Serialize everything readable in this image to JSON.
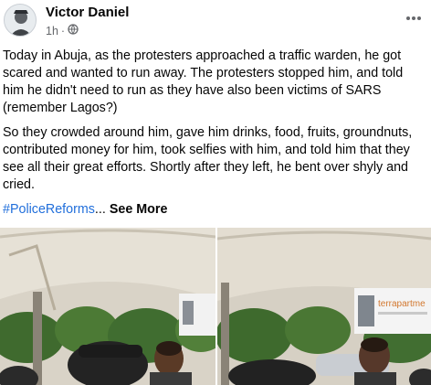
{
  "post": {
    "author": "Victor Daniel",
    "time": "1h",
    "time_separator": "·",
    "paragraph1": "Today in Abuja, as the protesters approached a traffic warden, he got scared and wanted to run away. The protesters stopped him, and told him he didn't need to run as they have also been victims of SARS (remember Lagos?)",
    "paragraph2": "So they crowded around him, gave him drinks, food, fruits, groundnuts, contributed money for him, took selfies with him, and told him that they see all their great efforts. Shortly after they left, he bent over shyly and cried.",
    "hashtag": "#PoliceReforms",
    "ellipsis": "...",
    "see_more": "See More"
  },
  "photos": {
    "right_banner_text": "terrapartme"
  },
  "icons": {
    "privacy": "globe-icon",
    "more": "more-horizontal-icon"
  },
  "colors": {
    "link": "#216fdb",
    "secondary_text": "#65676b"
  }
}
